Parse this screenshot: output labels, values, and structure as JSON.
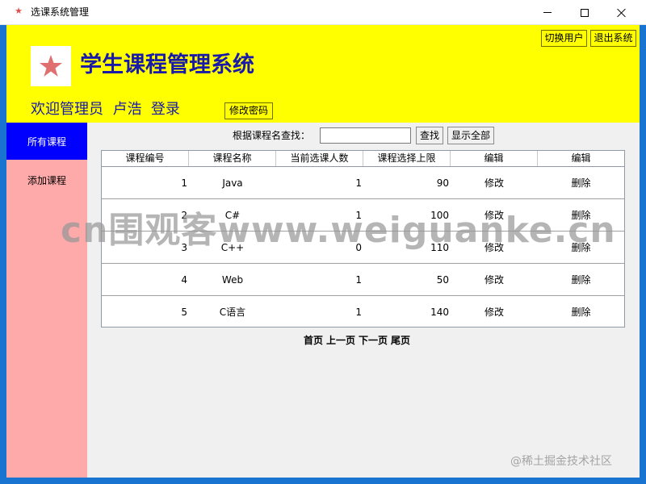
{
  "window": {
    "title": "选课系统管理"
  },
  "header": {
    "system_title": "学生课程管理系统",
    "welcome": "欢迎管理员  卢浩  登录",
    "switch_user_label": "切换用户",
    "exit_label": "退出系统",
    "change_password_label": "修改密码"
  },
  "sidebar": {
    "items": [
      {
        "label": "所有课程",
        "selected": true
      },
      {
        "label": "添加课程",
        "selected": false
      }
    ]
  },
  "search": {
    "label": "根据课程名查找：",
    "value": "",
    "search_label": "查找",
    "show_all_label": "显示全部"
  },
  "table": {
    "headers": [
      "课程编号",
      "课程名称",
      "当前选课人数",
      "课程选择上限",
      "编辑",
      "编辑"
    ],
    "rows": [
      {
        "id": "1",
        "name": "Java",
        "current": "1",
        "limit": "90",
        "edit": "修改",
        "delete": "删除"
      },
      {
        "id": "2",
        "name": "C#",
        "current": "1",
        "limit": "100",
        "edit": "修改",
        "delete": "删除"
      },
      {
        "id": "3",
        "name": "C++",
        "current": "0",
        "limit": "110",
        "edit": "修改",
        "delete": "删除"
      },
      {
        "id": "4",
        "name": "Web",
        "current": "1",
        "limit": "50",
        "edit": "修改",
        "delete": "删除"
      },
      {
        "id": "5",
        "name": "C语言",
        "current": "1",
        "limit": "140",
        "edit": "修改",
        "delete": "删除"
      }
    ]
  },
  "pagination": {
    "first": "首页",
    "prev": "上一页",
    "next": "下一页",
    "last": "尾页"
  },
  "watermarks": {
    "center": "cn围观客www.weiguanke.cn",
    "corner": "@稀土掘金技术社区"
  },
  "colors": {
    "header_bg": "#ffff00",
    "title_text": "#1a1aa8",
    "sidebar_bg": "#ffaaaa",
    "sidebar_selected_bg": "#0000ff",
    "content_bg": "#f0f0f0",
    "frame": "#1874d0",
    "logo_star": "#e07070"
  },
  "icons": {
    "app": "star-icon",
    "logo": "star-icon"
  }
}
